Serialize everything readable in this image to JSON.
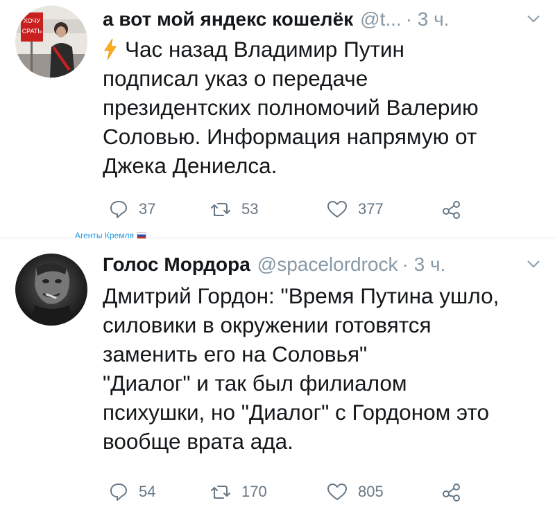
{
  "tweets": [
    {
      "author_name": "а вот мой яндекс кошелёк",
      "handle": "@t...",
      "time": "· 3 ч.",
      "body_lines": [
        "Час назад Владимир Путин",
        "подписал указ о передаче",
        "президентских полномочий Валерию",
        "Соловью. Информация напрямую от",
        "Джека Дениелса."
      ],
      "replies": "37",
      "retweets": "53",
      "likes": "377",
      "avatar_sign_text": "ХОЧУ СРАТЬ"
    },
    {
      "author_name": "Голос Мордора",
      "handle": "@spacelordrock",
      "time": "· 3 ч.",
      "body_lines": [
        "Дмитрий Гордон: \"Время Путина ушло,",
        "силовики в окружении готовятся",
        "заменить его на Соловья\"",
        "\"Диалог\" и так был филиалом",
        "психушки, но \"Диалог\" с Гордоном это",
        "вообще врата ада."
      ],
      "replies": "54",
      "retweets": "170",
      "likes": "805"
    }
  ],
  "divider_label": "Агенты Кремля",
  "colors": {
    "text": "#14171a",
    "muted": "#8899a6",
    "icon": "#657786",
    "bolt": "#ffad1f",
    "label": "#1b95e0"
  },
  "icons": [
    "lightning-icon",
    "reply-icon",
    "retweet-icon",
    "like-icon",
    "share-icon",
    "chevron-down-icon",
    "flag-icon"
  ]
}
